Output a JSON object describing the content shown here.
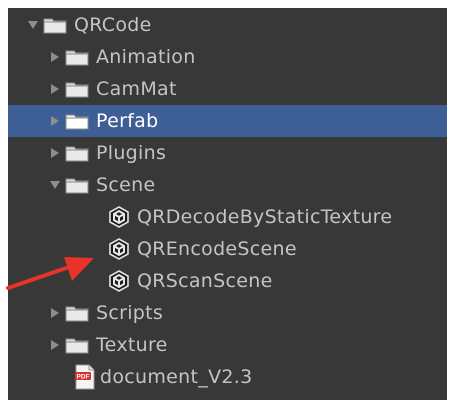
{
  "tree": {
    "items": [
      {
        "label": "QRCode",
        "depth": 0,
        "type": "folder",
        "expanded": true,
        "selected": false
      },
      {
        "label": "Animation",
        "depth": 1,
        "type": "folder",
        "expanded": false,
        "selected": false
      },
      {
        "label": "CamMat",
        "depth": 1,
        "type": "folder",
        "expanded": false,
        "selected": false
      },
      {
        "label": "Perfab",
        "depth": 1,
        "type": "folder",
        "expanded": false,
        "selected": true
      },
      {
        "label": "Plugins",
        "depth": 1,
        "type": "folder",
        "expanded": false,
        "selected": false
      },
      {
        "label": "Scene",
        "depth": 1,
        "type": "folder",
        "expanded": true,
        "selected": false
      },
      {
        "label": "QRDecodeByStaticTexture",
        "depth": 2,
        "type": "scene",
        "selected": false
      },
      {
        "label": "QREncodeScene",
        "depth": 2,
        "type": "scene",
        "selected": false
      },
      {
        "label": "QRScanScene",
        "depth": 2,
        "type": "scene",
        "selected": false
      },
      {
        "label": "Scripts",
        "depth": 1,
        "type": "folder",
        "expanded": false,
        "selected": false
      },
      {
        "label": "Texture",
        "depth": 1,
        "type": "folder",
        "expanded": false,
        "selected": false
      },
      {
        "label": "document_V2.3",
        "depth": 1,
        "type": "pdf",
        "selected": false
      }
    ]
  },
  "colors": {
    "panel_bg": "#383838",
    "selection": "#3e5f96",
    "text": "#c4c4c4",
    "annotation_arrow": "#e8332a"
  },
  "icons": {
    "folder": "folder-icon",
    "scene": "unity-scene-icon",
    "pdf": "pdf-file-icon",
    "expanded": "triangle-down-icon",
    "collapsed": "triangle-right-icon"
  }
}
